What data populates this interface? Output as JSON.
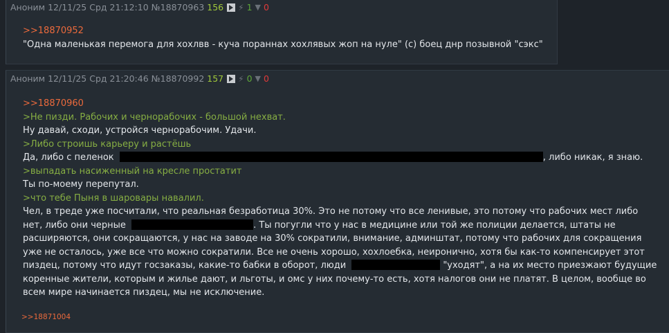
{
  "posts": [
    {
      "author": "Аноним",
      "datetime": "12/11/25 Срд 21:12:10",
      "number": "№18870963",
      "count": "156",
      "likes": "1",
      "dislikes": "0",
      "reply_link": ">>18870952",
      "text": "\"Одна маленькая перемога для хохлвв - куча пораннах хохлявых жоп на нуле\" (с) боец днр позывной \"сэкс\""
    },
    {
      "author": "Аноним",
      "datetime": "12/11/25 Срд 21:20:46",
      "number": "№18870992",
      "count": "157",
      "likes": "0",
      "dislikes": "0",
      "reply_link": ">>18870960",
      "lines": {
        "q1": ">Не пизди. Рабочих и чернорабочих - большой нехват.",
        "t1": "Ну давай, сходи, устройся чернорабочим. Удачи.",
        "q2": ">Либо строишь карьеру и растёшь",
        "t2a": "Да, либо с пеленок",
        "t2b": ", либо никак, я знаю.",
        "q3": ">выпадать насиженный на кресле простатит",
        "t3": "Ты по-моему перепутал.",
        "q4": ">что тебе Пыня в шаровары навалил.",
        "p1": "Чел, в треде уже посчитали, что реальная безработица 30%. Это не потому что все ленивые, это потому что рабочих мест либо",
        "p2a": "нет, либо они черные",
        "p2b": ". Ты погугли что у нас в медицине или той же полиции делается, штаты не",
        "p3": "расширяются, они сокращаются, у нас на заводе на 30% сократили, внимание, админштат, потому что рабочих для сокращения",
        "p4": "уже не осталось, уже все что можно сократили. Все не очень хорошо, хохлоебка, неиронично, хотя бы как-то компенсирует этот",
        "p5a": "пиздец, потому что идут госзаказы, какие-то бабки в оборот, люди",
        "p5b": "\"уходят\", а на их место приезжают будущие",
        "p6": "коренные жители, которым и жилье дают, и льготы, и омс у них почему-то есть, хотя налогов они не платят. В целом, вообще во",
        "p7": "всем мире начинается пиздец, мы не исключение."
      },
      "backlink": ">>18871004"
    }
  ]
}
